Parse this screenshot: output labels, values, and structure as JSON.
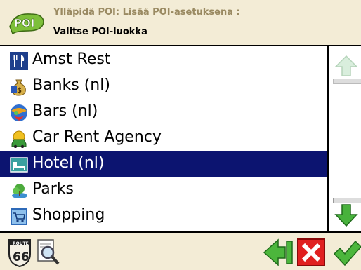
{
  "header": {
    "breadcrumb": "Ylläpidä POI: Lisää POI-asetuksena :",
    "title": "Valitse POI-luokka",
    "logo_icon": "poi-logo-icon"
  },
  "list": {
    "items": [
      {
        "label": "Amst Rest",
        "icon": "restaurant-icon",
        "selected": false
      },
      {
        "label": "Banks  (nl)",
        "icon": "money-bag-icon",
        "selected": false
      },
      {
        "label": "Bars  (nl)",
        "icon": "cocktail-icon",
        "selected": false
      },
      {
        "label": "Car  Rent  Agency",
        "icon": "car-icon",
        "selected": false
      },
      {
        "label": "Hotel (nl)",
        "icon": "bed-icon",
        "selected": true
      },
      {
        "label": "Parks",
        "icon": "tree-icon",
        "selected": false
      },
      {
        "label": "Shopping",
        "icon": "shopping-cart-icon",
        "selected": false
      }
    ]
  },
  "scrollbar": {
    "up_icon": "arrow-up-icon",
    "down_icon": "arrow-down-icon"
  },
  "footer": {
    "buttons": [
      {
        "name": "route66-icon",
        "label": "66"
      },
      {
        "name": "magnifier-icon"
      },
      {
        "name": "back-icon"
      },
      {
        "name": "cancel-icon"
      },
      {
        "name": "ok-icon"
      }
    ]
  },
  "colors": {
    "background": "#f3ecd6",
    "selection": "#0c1470",
    "accent_green": "#3cb040",
    "cancel_red": "#e02020"
  }
}
